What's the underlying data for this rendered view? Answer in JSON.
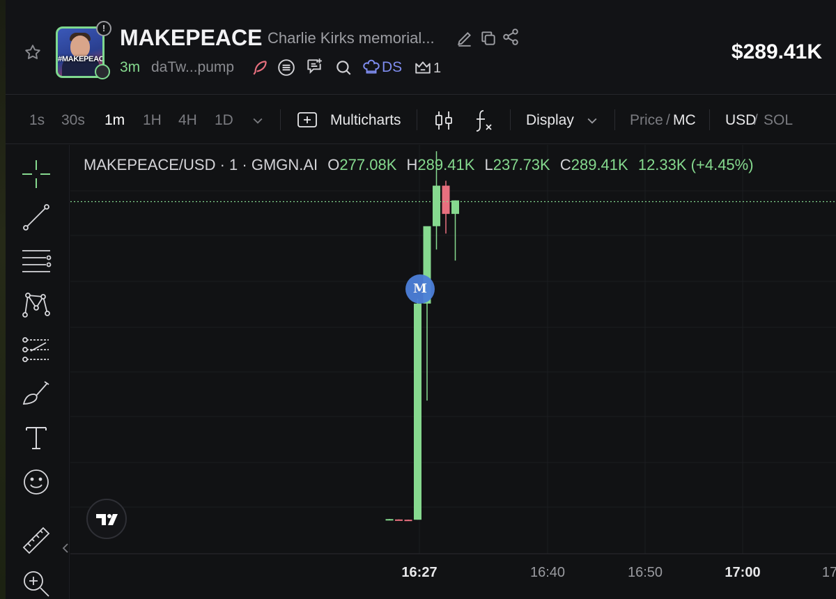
{
  "header": {
    "token_name": "MAKEPEACE",
    "description": "Charlie Kirks memorial...",
    "avatar_tag": "#MAKEPEACE",
    "info_badge": "!",
    "age": "3m",
    "address": "daTw...pump",
    "ds_label": "DS",
    "crown_count": "1",
    "market_cap": "$289.41K",
    "icons": [
      "star-icon",
      "edit-icon",
      "copy-icon",
      "share-icon",
      "feather-icon",
      "list-icon",
      "chat-icon",
      "search-icon",
      "chef-hat-icon",
      "crown-icon"
    ]
  },
  "toolbar": {
    "intervals": [
      "1s",
      "30s",
      "1m",
      "1H",
      "4H",
      "1D"
    ],
    "active_interval": "1m",
    "multicharts": "Multicharts",
    "display": "Display",
    "price_label": "Price",
    "slash": "/",
    "mc_label": "MC",
    "usd_label": "USD",
    "sol_label": "SOL"
  },
  "tools": [
    "crosshair-icon",
    "trendline-icon",
    "fib-icon",
    "pattern-icon",
    "projection-icon",
    "brush-icon",
    "text-icon",
    "emoji-icon",
    "ruler-icon",
    "zoom-in-icon"
  ],
  "legend": {
    "symbol": "MAKEPEACE/USD · 1 · GMGN.AI",
    "o_label": "O",
    "o_value": "277.08K",
    "h_label": "H",
    "h_value": "289.41K",
    "l_label": "L",
    "l_value": "237.73K",
    "c_label": "C",
    "c_value": "289.41K",
    "change": "12.33K (+4.45%)"
  },
  "marker_label": "M",
  "colors": {
    "up": "#86d98f",
    "down": "#e8707f",
    "accent": "#4c7fd9",
    "background": "#111214"
  },
  "chart_data": {
    "type": "candlestick",
    "x_ticks": [
      "16:27",
      "16:40",
      "16:50",
      "17:00",
      "17"
    ],
    "bold_ticks": [
      "16:27",
      "17:00"
    ],
    "y_range": [
      0,
      300
    ],
    "candles": [
      {
        "o": 5.5,
        "h": 5.6,
        "l": 5.3,
        "c": 5.5,
        "dir": "up"
      },
      {
        "o": 5.2,
        "h": 5.3,
        "l": 4.6,
        "c": 5.0,
        "dir": "down"
      },
      {
        "o": 5.0,
        "h": 5.1,
        "l": 4.8,
        "c": 5.0,
        "dir": "down"
      },
      {
        "o": 5.0,
        "h": 185,
        "l": 5.0,
        "c": 181,
        "dir": "up"
      },
      {
        "o": 181,
        "h": 240,
        "l": 102,
        "c": 244,
        "dir": "up"
      },
      {
        "o": 244,
        "h": 305,
        "l": 225,
        "c": 277,
        "dir": "up"
      },
      {
        "o": 277,
        "h": 281,
        "l": 238,
        "c": 254,
        "dir": "down"
      },
      {
        "o": 254,
        "h": 265,
        "l": 216,
        "c": 265,
        "dir": "up"
      }
    ],
    "last_price_line": 264
  }
}
